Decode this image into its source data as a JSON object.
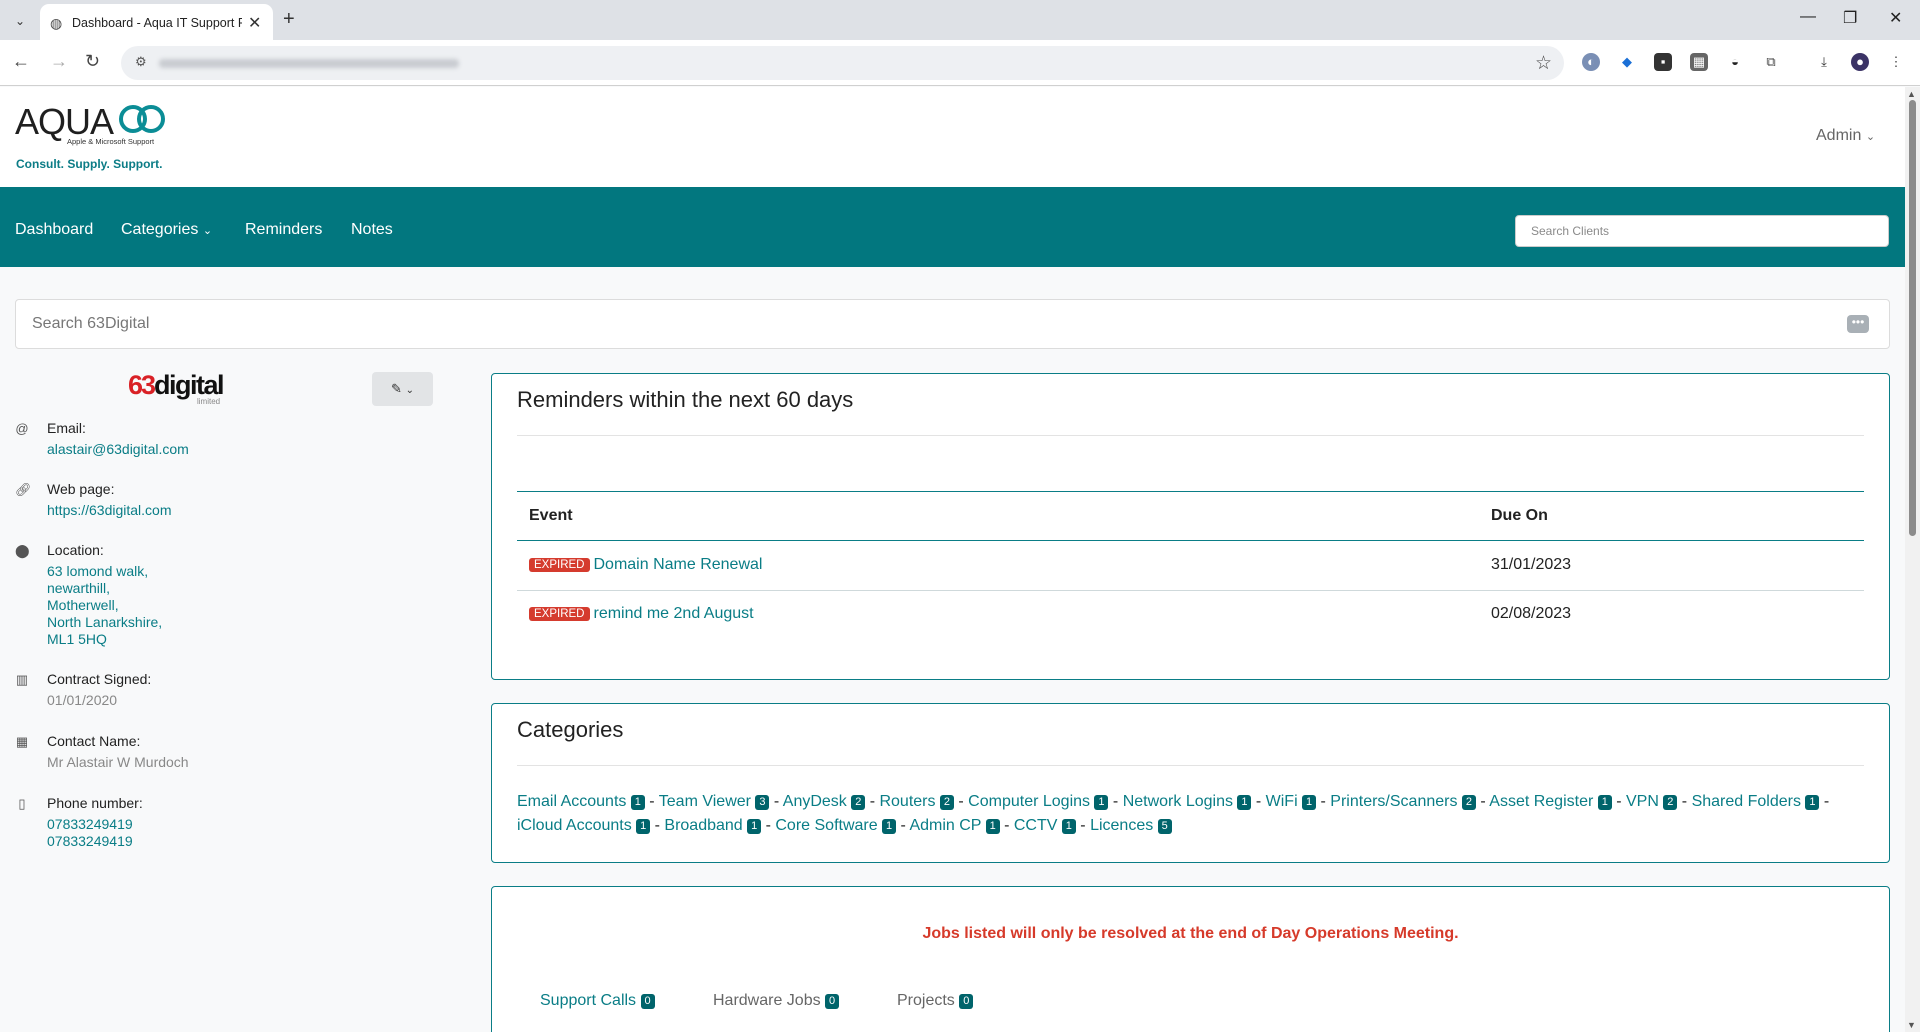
{
  "browser": {
    "tab_title": "Dashboard - Aqua IT Support P",
    "close_glyph": "✕",
    "new_tab_glyph": "+"
  },
  "header": {
    "logo_word": "AQUA",
    "logo_sub": "Apple & Microsoft Support",
    "tagline": "Consult. Supply. Support.",
    "user_menu": "Admin"
  },
  "nav": {
    "items": [
      "Dashboard",
      "Categories",
      "Reminders",
      "Notes"
    ],
    "search_placeholder": "Search Clients"
  },
  "main_search": {
    "placeholder": "Search 63Digital"
  },
  "client": {
    "logo_number": "63",
    "logo_word": "digital",
    "logo_suffix": "limited",
    "fields": [
      {
        "icon": "at-icon",
        "label": "Email:",
        "value": [
          "alastair@63digital.com"
        ],
        "link": true
      },
      {
        "icon": "link-icon",
        "label": "Web page:",
        "value": [
          "https://63digital.com"
        ],
        "link": true
      },
      {
        "icon": "location-pin-icon",
        "label": "Location:",
        "value": [
          "63 lomond walk,",
          "newarthill,",
          "Motherwell,",
          "North Lanarkshire,",
          "ML1 5HQ"
        ],
        "link": true
      },
      {
        "icon": "calendar-icon",
        "label": "Contract Signed:",
        "value": [
          "01/01/2020"
        ],
        "link": false
      },
      {
        "icon": "building-icon",
        "label": "Contact Name:",
        "value": [
          "Mr Alastair W Murdoch"
        ],
        "link": false
      },
      {
        "icon": "phone-icon",
        "label": "Phone number:",
        "value": [
          "07833249419",
          "07833249419"
        ],
        "link": true
      }
    ]
  },
  "reminders": {
    "title": "Reminders within the next 60 days",
    "col_event": "Event",
    "col_due": "Due On",
    "rows": [
      {
        "status": "EXPIRED",
        "event": "Domain Name Renewal",
        "due": "31/01/2023"
      },
      {
        "status": "EXPIRED",
        "event": "remind me 2nd August",
        "due": "02/08/2023"
      }
    ]
  },
  "categories": {
    "title": "Categories",
    "items": [
      {
        "name": "Email Accounts",
        "count": "1"
      },
      {
        "name": "Team Viewer",
        "count": "3"
      },
      {
        "name": "AnyDesk",
        "count": "2"
      },
      {
        "name": "Routers",
        "count": "2"
      },
      {
        "name": "Computer Logins",
        "count": "1"
      },
      {
        "name": "Network Logins",
        "count": "1"
      },
      {
        "name": "WiFi",
        "count": "1"
      },
      {
        "name": "Printers/Scanners",
        "count": "2"
      },
      {
        "name": "Asset Register",
        "count": "1"
      },
      {
        "name": "VPN",
        "count": "2"
      },
      {
        "name": "Shared Folders",
        "count": "1"
      },
      {
        "name": "iCloud Accounts",
        "count": "1"
      },
      {
        "name": "Broadband",
        "count": "1"
      },
      {
        "name": "Core Software",
        "count": "1"
      },
      {
        "name": "Admin CP",
        "count": "1"
      },
      {
        "name": "CCTV",
        "count": "1"
      },
      {
        "name": "Licences",
        "count": "5"
      }
    ]
  },
  "jobs": {
    "notice": "Jobs listed will only be resolved at the end of Day Operations Meeting.",
    "tabs": [
      {
        "label": "Support Calls",
        "count": "0"
      },
      {
        "label": "Hardware Jobs",
        "count": "0"
      },
      {
        "label": "Projects",
        "count": "0"
      }
    ]
  },
  "colors": {
    "brand": "#02777f",
    "link": "#0a7d86",
    "expired": "#d53b2e",
    "notice": "#d63a2a"
  }
}
